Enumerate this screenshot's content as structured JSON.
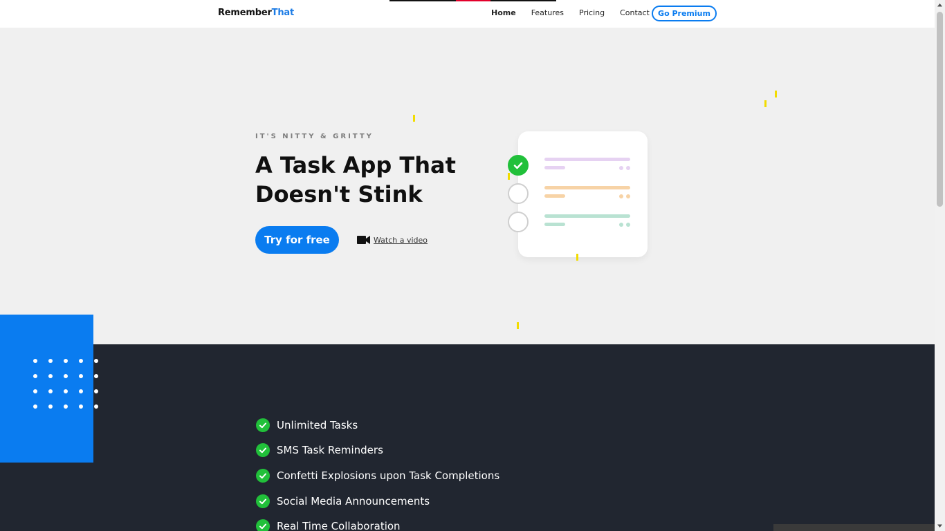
{
  "navbar": {
    "logo_main": "Remember",
    "logo_accent": "That",
    "links": [
      "Home",
      "Features",
      "Pricing",
      "Contact"
    ],
    "premium_label": "Go Premium"
  },
  "hero": {
    "eyebrow": "IT'S NITTY & GRITTY",
    "headline": "A Task App That Doesn't Stink",
    "try_label": "Try for free",
    "video_label": "Watch a video",
    "video_icon": "video-camera-icon"
  },
  "task_card": {
    "rows": [
      {
        "done": true,
        "color": "#e6d2f2",
        "dot_color": "#e6d2f2"
      },
      {
        "done": false,
        "color": "#f7d3a6",
        "dot_color": "#f7d3a6"
      },
      {
        "done": false,
        "color": "#b9e2d2",
        "dot_color": "#b9e2d2"
      }
    ]
  },
  "features": {
    "items": [
      "Unlimited Tasks",
      "SMS Task Reminders",
      "Confetti Explosions upon Task Completions",
      "Social Media Announcements",
      "Real Time Collaboration"
    ]
  },
  "colors": {
    "primary": "#0a7cf0",
    "success": "#21c03a",
    "dark": "#212630",
    "confetti": "#f2dc00"
  }
}
